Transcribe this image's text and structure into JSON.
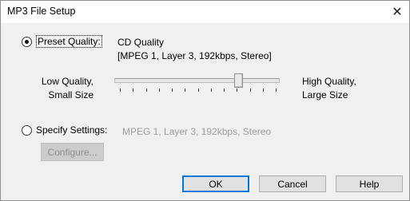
{
  "window": {
    "title": "MP3 File Setup"
  },
  "preset": {
    "label": "Preset Quality:",
    "selected": true,
    "name": "CD Quality",
    "description": "[MPEG 1, Layer 3, 192kbps, Stereo]"
  },
  "quality_slider": {
    "low_label_line1": "Low Quality,",
    "low_label_line2": "Small Size",
    "high_label_line1": "High Quality,",
    "high_label_line2": "Large Size",
    "tick_count": 13,
    "value_fraction": 0.76
  },
  "specify": {
    "label": "Specify Settings:",
    "selected": false,
    "value": "MPEG 1, Layer 3, 192kbps, Stereo",
    "configure_label": "Configure..."
  },
  "buttons": {
    "ok": "OK",
    "cancel": "Cancel",
    "help": "Help"
  }
}
